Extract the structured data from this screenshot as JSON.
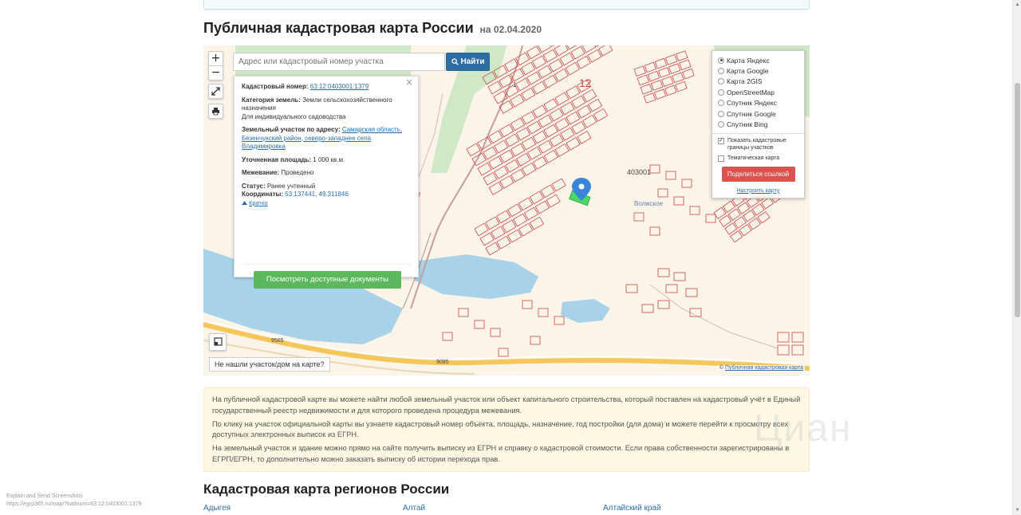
{
  "page": {
    "title": "Публичная кадастровая карта России",
    "date": "на 02.04.2020"
  },
  "map": {
    "zoom_in": "+",
    "zoom_out": "−",
    "search_placeholder": "Адрес или кадастровый номер участка",
    "search_button": "Найти",
    "not_found": "Не нашли участок/дом на карте?",
    "copyright_prefix": "© ",
    "copyright_link": "Публичная кадастровая карта",
    "map_labels": [
      "403001",
      "Волжское",
      "9585",
      "9585",
      "9085",
      "12",
      "1"
    ]
  },
  "popup": {
    "cad_label": "Кадастровый номер:",
    "cad_value": "63:12:0403001:1379",
    "category_label": "Категория земель:",
    "category_value": "Земли сельскохозяйственного назначения",
    "purpose": "Для индивидуального садоводства",
    "address_label": "Земельный участок по адресу:",
    "address_value": "Самарская область, Безенчукский район, северо-западнее села Владимировка",
    "area_label": "Уточненная площадь:",
    "area_value": "1 000 кв.м.",
    "survey_label": "Межевание:",
    "survey_value": "Проведено",
    "status_label": "Статус:",
    "status_value": "Ранее учтенный",
    "coords_label": "Координаты:",
    "coords_value": "53.137441, 49.311846",
    "brief_link": "Кратко",
    "docs_button": "Посмотреть доступные документы"
  },
  "layers": {
    "options": [
      {
        "label": "Карта Яндекс",
        "selected": true
      },
      {
        "label": "Карта Google",
        "selected": false
      },
      {
        "label": "Карта 2GIS",
        "selected": false
      },
      {
        "label": "OpenStreetMap",
        "selected": false
      },
      {
        "label": "Спутник Яндекс",
        "selected": false
      },
      {
        "label": "Спутник Google",
        "selected": false
      },
      {
        "label": "Спутник Bing",
        "selected": false
      }
    ],
    "show_borders": "Показать кадастровые границы участков",
    "show_borders_checked": true,
    "thematic": "Тематическая карта",
    "thematic_checked": false,
    "share_button": "Поделиться ссылкой",
    "configure_link": "Настроить карту"
  },
  "info": {
    "p1": "На публичной кадастровой карте вы можете найти любой земельный участок или объект капитального строительства, который поставлен на кадастровый учёт в Единый государственный реестр недвижимости и для которого проведена процедура межевания.",
    "p2": "По клику на участок официальной карты вы узнаете кадастровый номер объекта, площадь, назначение, год постройки (для дома) и можете перейти к просмотру всех доступных электронных выписок из ЕГРН.",
    "p3": "На земельный участок и здание можно прямо на сайте получить выписку из ЕГРН и справку о кадастровой стоимости. Если права собственности зарегистрированы в ЕГРП/ЕГРН, то дополнительно можно заказать выписку об истории перехода прав.",
    "watermark": "Циан"
  },
  "regions": {
    "title": "Кадастровая карта регионов России",
    "items": [
      "Адыгея",
      "Алтай",
      "Алтайский край"
    ]
  },
  "extension_note": {
    "line1": "Explain and Send Screenshots",
    "line2": "https://egrp365.ru/map/?kadnum=63:12:0403001:1379"
  },
  "colors": {
    "accent": "#2e6da4",
    "docs_green": "#5cb85c",
    "share_red": "#d9534f",
    "parcel_red": "#d0454a",
    "water": "#a8d2ea"
  }
}
